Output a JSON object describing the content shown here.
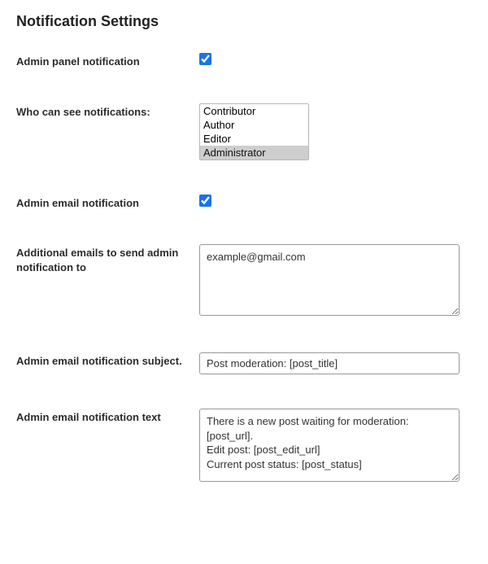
{
  "heading": "Notification Settings",
  "fields": {
    "admin_panel_notify": {
      "label": "Admin panel notification",
      "checked": true
    },
    "who_can_see": {
      "label": "Who can see notifications:",
      "options": [
        "Contributor",
        "Author",
        "Editor",
        "Administrator"
      ],
      "selected": "Administrator"
    },
    "admin_email_notify": {
      "label": "Admin email notification",
      "checked": true
    },
    "additional_emails": {
      "label": "Additional emails to send admin notification to",
      "value": "example@gmail.com"
    },
    "email_subject": {
      "label": "Admin email notification subject.",
      "value": "Post moderation: [post_title]"
    },
    "email_text": {
      "label": "Admin email notification text",
      "value": "There is a new post waiting for moderation: [post_url].\nEdit post: [post_edit_url]\nCurrent post status: [post_status]"
    }
  }
}
